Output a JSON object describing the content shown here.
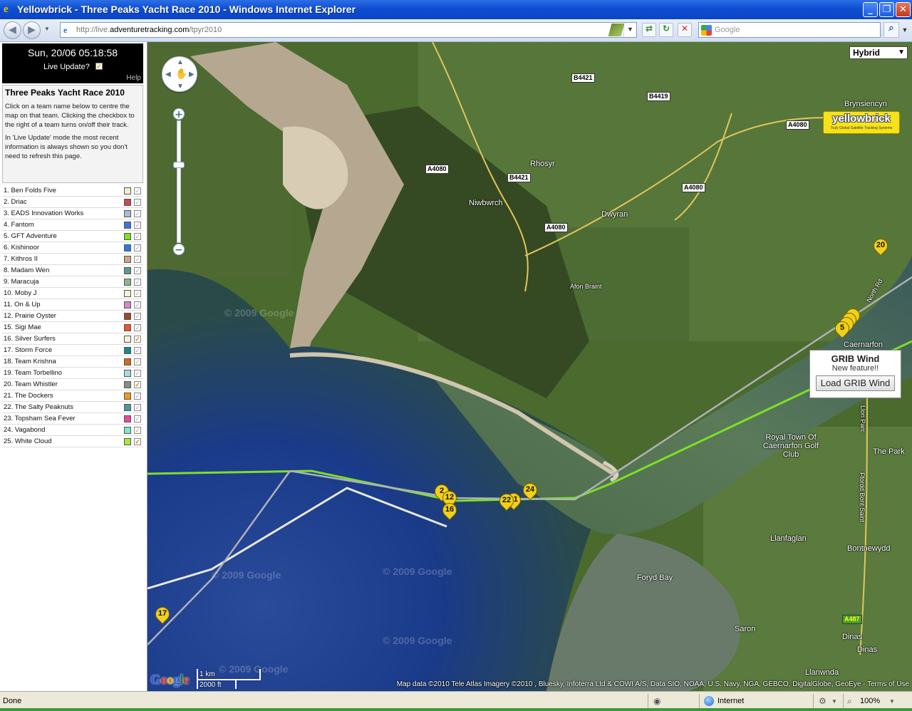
{
  "window": {
    "title": "Yellowbrick - Three Peaks Yacht Race 2010 - Windows Internet Explorer"
  },
  "addressbar": {
    "url_prefix": "http://live.",
    "url_domain": "adventuretracking.com",
    "url_path": "/tpyr2010",
    "search_placeholder": "Google"
  },
  "sidebar": {
    "datetime": "Sun, 20/06 05:18:58",
    "live_update_label": "Live Update?",
    "live_update_checked": true,
    "help_label": "Help",
    "title": "Three Peaks Yacht Race 2010",
    "para1": "Click on a team name below to centre the map on that team. Clicking the checkbox to the right of a team turns on/off their track.",
    "para2": "In 'Live Update' mode the most recent information is always shown so you don't need to refresh this page.",
    "teams": [
      {
        "label": "1. Ben Folds Five",
        "color": "#f7ecc8",
        "checked": false
      },
      {
        "label": "2. Driac",
        "color": "#c84a4a",
        "checked": false
      },
      {
        "label": "3. EADS Innovation Works",
        "color": "#a8bcd4",
        "checked": false
      },
      {
        "label": "4. Fantom",
        "color": "#3a78d8",
        "checked": false
      },
      {
        "label": "5. GFT Adventure",
        "color": "#7ce024",
        "checked": false
      },
      {
        "label": "6. Kishinoor",
        "color": "#2a7ae8",
        "checked": false
      },
      {
        "label": "7. Kithros II",
        "color": "#c8a88a",
        "checked": false
      },
      {
        "label": "8. Madam Wen",
        "color": "#5a9a8a",
        "checked": false
      },
      {
        "label": "9. Maracuja",
        "color": "#8ab88a",
        "checked": false
      },
      {
        "label": "10. Moby J",
        "color": "#f7f0c8",
        "checked": false
      },
      {
        "label": "11. On & Up",
        "color": "#d888c8",
        "checked": false
      },
      {
        "label": "12. Prairie Oyster",
        "color": "#9a4a2a",
        "checked": false
      },
      {
        "label": "15. Sigi Mae",
        "color": "#e8582a",
        "checked": false
      },
      {
        "label": "16. Silver Surfers",
        "color": "#f7f0d8",
        "checked": true
      },
      {
        "label": "17. Storm Force",
        "color": "#1a8a8a",
        "checked": false
      },
      {
        "label": "18. Team Krishna",
        "color": "#d8681a",
        "checked": false
      },
      {
        "label": "19. Team Torbellino",
        "color": "#a8d8e8",
        "checked": false
      },
      {
        "label": "20. Team Whistler",
        "color": "#8a8a8a",
        "checked": true
      },
      {
        "label": "21. The Dockers",
        "color": "#f09a1a",
        "checked": false
      },
      {
        "label": "22. The Salty Peaknuts",
        "color": "#4a9a9a",
        "checked": false
      },
      {
        "label": "23. Topsham Sea Fever",
        "color": "#e84a98",
        "checked": false
      },
      {
        "label": "24. Vagabond",
        "color": "#7ae8c8",
        "checked": false
      },
      {
        "label": "25. White Cloud",
        "color": "#a8e83a",
        "checked": true
      }
    ]
  },
  "map": {
    "map_type": "Hybrid",
    "logo_brand": "yellowbrick",
    "logo_tagline": "Truly Global Satellite Tracking Systems",
    "grib": {
      "title": "GRIB Wind",
      "subtitle": "New feature!!",
      "button": "Load GRIB Wind"
    },
    "places": [
      "Brynsiencyn",
      "Rhosyr",
      "Niwbwrch",
      "Dwyran",
      "Afon Braint",
      "Caernarfon",
      "Royal Town Of Caernarfon Golf Club",
      "The Park",
      "Llanfaglan",
      "Bontnewydd",
      "Foryd Bay",
      "Saron",
      "Dinas",
      "Dinas",
      "Llanwnda",
      "North Rd",
      "Ffordd Bont Saint",
      "Llon Parc"
    ],
    "roads": [
      "B4421",
      "B4419",
      "A4080",
      "A4080",
      "B4421",
      "A4080",
      "A4080",
      "A487"
    ],
    "markers": [
      "20",
      "5",
      "2",
      "12",
      "16",
      "22",
      "11",
      "24",
      "17"
    ],
    "scale_km": "1 km",
    "scale_ft": "2000 ft",
    "google_logo": "Google",
    "watermark": "© 2009 Google",
    "attribution": "Map data ©2010 Tele Atlas  Imagery ©2010 , Bluesky, Infoterra Ltd & COWI A/S, Data SIO, NOAA, U.S. Navy, NGA, GEBCO, DigitalGlobe, GeoEye - Terms of Use"
  },
  "statusbar": {
    "status": "Done",
    "zone": "Internet",
    "zoom": "100%"
  }
}
